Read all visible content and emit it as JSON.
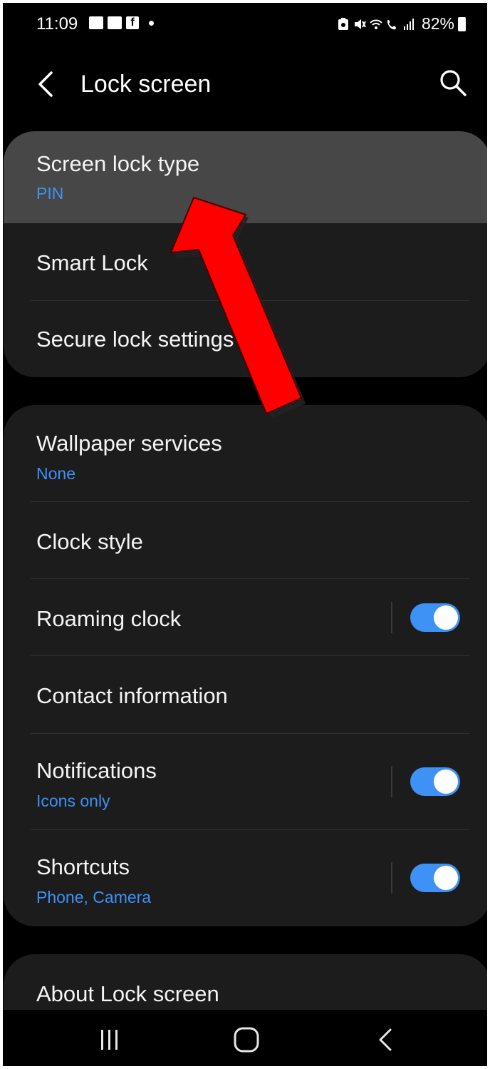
{
  "status_bar": {
    "time": "11:09",
    "battery_percent": "82%",
    "left_icons": [
      "voicemail-icon",
      "gallery-icon",
      "facebook-icon",
      "dot-icon"
    ],
    "right_icons": [
      "battery-saver-icon",
      "mute-icon",
      "wifi-icon",
      "wifi-calling-icon",
      "signal-icon",
      "battery-icon"
    ]
  },
  "header": {
    "title": "Lock screen",
    "back_icon": "chevron-left-icon",
    "search_icon": "search-icon"
  },
  "groups": [
    {
      "items": [
        {
          "title": "Screen lock type",
          "subtitle": "PIN",
          "highlighted": true
        },
        {
          "title": "Smart Lock"
        },
        {
          "title": "Secure lock settings"
        }
      ]
    },
    {
      "items": [
        {
          "title": "Wallpaper services",
          "subtitle": "None"
        },
        {
          "title": "Clock style"
        },
        {
          "title": "Roaming clock",
          "toggle": true
        },
        {
          "title": "Contact information"
        },
        {
          "title": "Notifications",
          "subtitle": "Icons only",
          "toggle": true
        },
        {
          "title": "Shortcuts",
          "subtitle": "Phone, Camera",
          "toggle": true
        }
      ]
    },
    {
      "items": [
        {
          "title": "About Lock screen"
        }
      ]
    }
  ],
  "nav_bar": {
    "buttons": [
      "recents-icon",
      "home-icon",
      "back-icon"
    ]
  },
  "annotation": {
    "type": "arrow",
    "color": "#ff0000",
    "points_to": "Screen lock type"
  },
  "colors": {
    "accent": "#3e91f5",
    "card_background": "#1c1c1c",
    "highlight": "#474747",
    "background": "#000000"
  }
}
